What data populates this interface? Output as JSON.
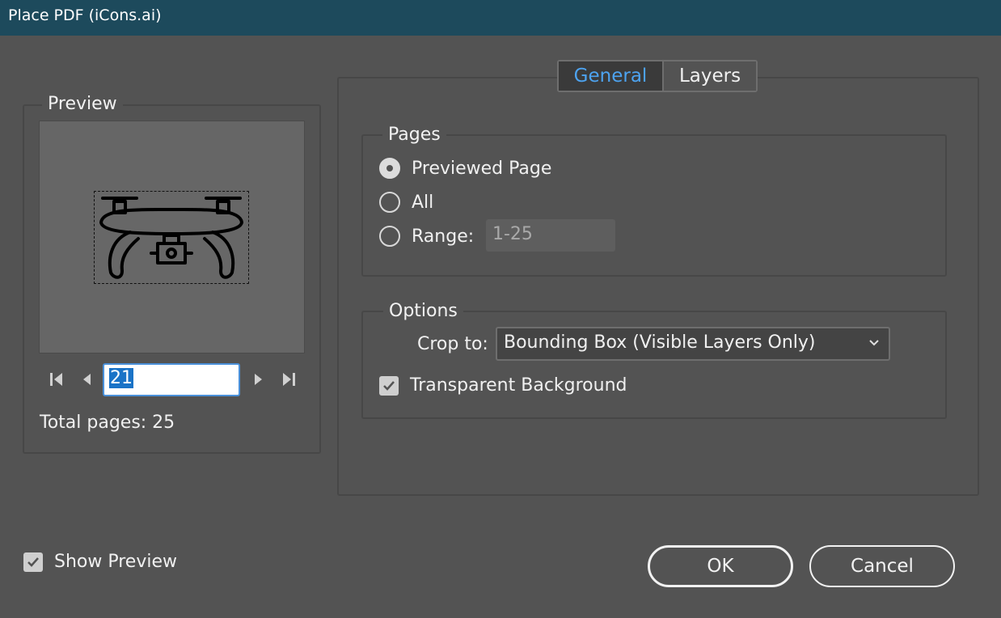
{
  "window": {
    "title": "Place PDF (iCons.ai)"
  },
  "preview": {
    "legend": "Preview",
    "current_page": "21",
    "total_pages_label": "Total pages: 25"
  },
  "tabs": [
    {
      "label": "General",
      "active": true
    },
    {
      "label": "Layers",
      "active": false
    }
  ],
  "pages": {
    "legend": "Pages",
    "options": [
      {
        "label": "Previewed Page",
        "checked": true
      },
      {
        "label": "All",
        "checked": false
      },
      {
        "label": "Range:",
        "checked": false
      }
    ],
    "range_value": "1-25"
  },
  "options": {
    "legend": "Options",
    "crop_label": "Crop to:",
    "crop_value": "Bounding Box (Visible Layers Only)",
    "transparent_label": "Transparent Background",
    "transparent_checked": true
  },
  "footer": {
    "show_preview_label": "Show Preview",
    "show_preview_checked": true,
    "ok_label": "OK",
    "cancel_label": "Cancel"
  },
  "colors": {
    "titlebar": "#1d4a5c",
    "background": "#535353",
    "active_tab_text": "#4da3f0",
    "selection": "#1a73c7"
  },
  "icons": [
    "first-page-icon",
    "prev-page-icon",
    "next-page-icon",
    "last-page-icon",
    "drone-thumbnail",
    "chevron-down-icon",
    "checkmark-icon"
  ]
}
